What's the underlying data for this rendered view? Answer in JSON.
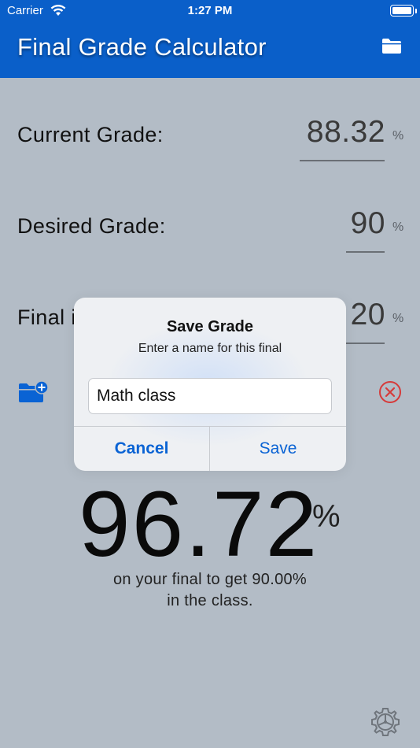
{
  "status_bar": {
    "carrier": "Carrier",
    "time": "1:27 PM"
  },
  "nav": {
    "title": "Final Grade Calculator",
    "folder_icon": "folder-icon"
  },
  "rows": [
    {
      "label": "Current Grade:",
      "value": "88.32",
      "unit": "%"
    },
    {
      "label": "Desired Grade:",
      "value": "90",
      "unit": "%"
    },
    {
      "label": "Final i",
      "value": "20",
      "unit": "%"
    }
  ],
  "result": {
    "value": "96.72",
    "unit": "%",
    "line1": "on your final to get 90.00%",
    "line2": "in the class."
  },
  "alert": {
    "title": "Save Grade",
    "message": "Enter a name for this final",
    "input_value": "Math class",
    "cancel_label": "Cancel",
    "save_label": "Save"
  },
  "colors": {
    "nav_bg": "#0a5fc9",
    "page_bg": "#b3bcc6",
    "accent": "#0a63d4",
    "clear_icon": "#d63a3a"
  }
}
